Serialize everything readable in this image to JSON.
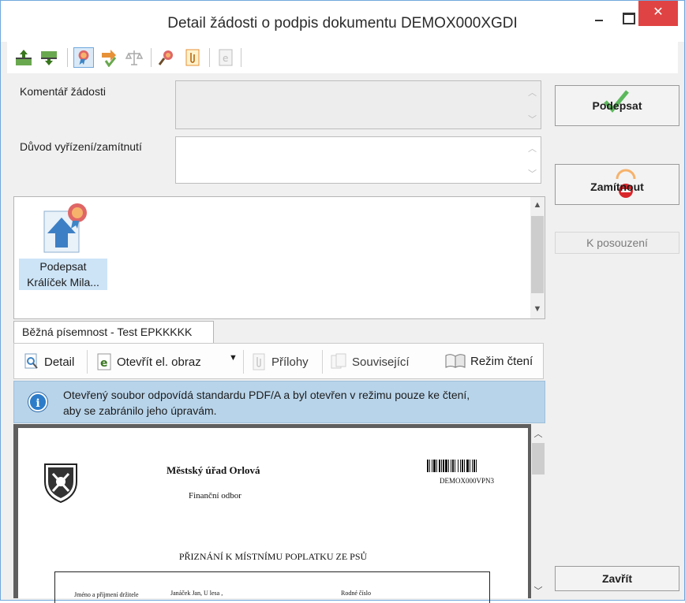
{
  "window": {
    "title": "Detail žádosti o podpis dokumentu DEMOX000XGDI",
    "close_glyph": "✕"
  },
  "toolbar": {
    "icons": [
      "upload-green-icon",
      "download-green-icon",
      "certificate-icon",
      "arrow-sign-icon",
      "scales-icon",
      "magnifier-seal-icon",
      "attachment-icon",
      "e-document-icon"
    ]
  },
  "form": {
    "comment_label": "Komentář žádosti",
    "comment_value": "",
    "reason_label": "Důvod vyřízení/zamítnutí",
    "reason_value": ""
  },
  "workflow": {
    "items": [
      {
        "label_line1": "Podepsat",
        "label_line2": "Králíček Mila..."
      }
    ]
  },
  "document_tab": {
    "label": "Běžná písemnost - Test EPKKKKK"
  },
  "doc_toolbar": {
    "detail": "Detail",
    "open_image": "Otevřít el. obraz",
    "attachments": "Přílohy",
    "related": "Související",
    "reading_mode": "Režim čtení"
  },
  "info": {
    "line1": "Otevřený soubor odpovídá standardu PDF/A a byl otevřen v režimu pouze ke čtení,",
    "line2": "aby se zabránilo jeho úpravám."
  },
  "document": {
    "office": "Městský úřad Orlová",
    "department": "Finanční odbor",
    "barcode_text": "DEMOX000VPN3",
    "heading": "PŘIZNÁNÍ K MÍSTNÍMU POPLATKU ZE PSŮ",
    "row_label": "Jméno a příjmení držitele",
    "row_value": "Janáček Jan, U lesa ,",
    "row_label2": "Rodné číslo"
  },
  "actions": {
    "sign": "Podepsat",
    "reject": "Zamítnout",
    "review": "K posouzení",
    "close": "Zavřít"
  },
  "colors": {
    "accent": "#2c7cc9",
    "info_bg": "#b8d4ea",
    "close_red": "#e04343",
    "selection": "#cde4f7"
  }
}
